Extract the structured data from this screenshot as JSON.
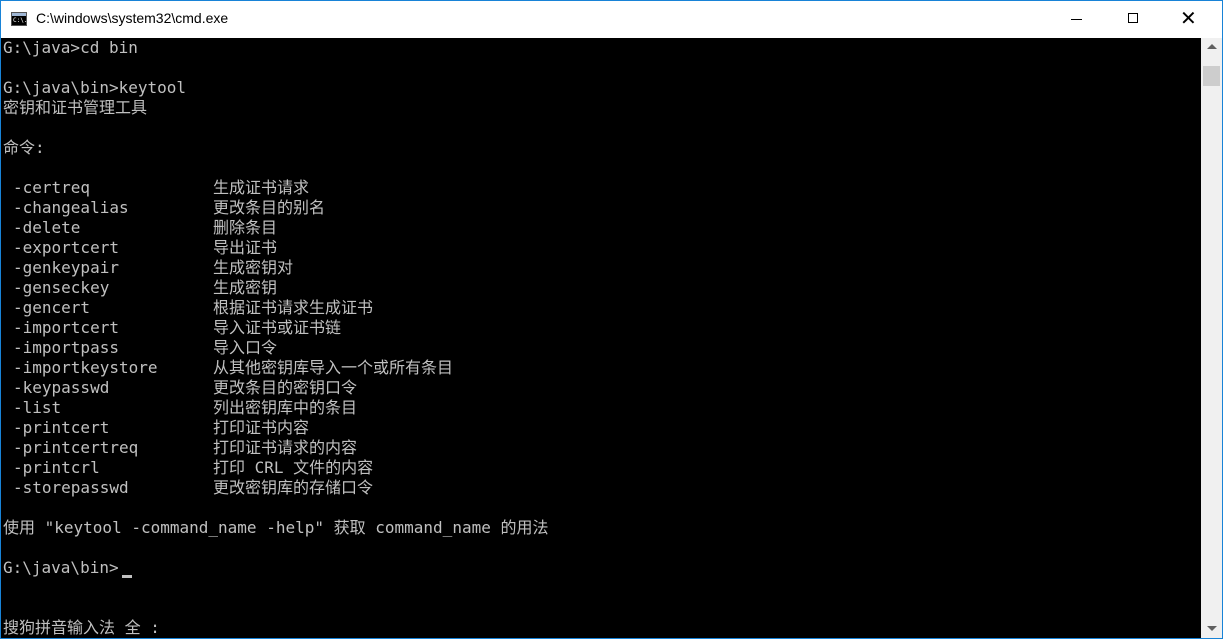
{
  "window": {
    "title": "C:\\windows\\system32\\cmd.exe",
    "icon_text": "C:\\."
  },
  "console": {
    "prompt_cd": "G:\\java>cd bin",
    "prompt_keytool": "G:\\java\\bin>keytool",
    "heading": "密钥和证书管理工具",
    "commands_label": "命令:",
    "commands": [
      {
        "name": "-certreq",
        "desc": "生成证书请求"
      },
      {
        "name": "-changealias",
        "desc": "更改条目的别名"
      },
      {
        "name": "-delete",
        "desc": "删除条目"
      },
      {
        "name": "-exportcert",
        "desc": "导出证书"
      },
      {
        "name": "-genkeypair",
        "desc": "生成密钥对"
      },
      {
        "name": "-genseckey",
        "desc": "生成密钥"
      },
      {
        "name": "-gencert",
        "desc": "根据证书请求生成证书"
      },
      {
        "name": "-importcert",
        "desc": "导入证书或证书链"
      },
      {
        "name": "-importpass",
        "desc": "导入口令"
      },
      {
        "name": "-importkeystore",
        "desc": "从其他密钥库导入一个或所有条目"
      },
      {
        "name": "-keypasswd",
        "desc": "更改条目的密钥口令"
      },
      {
        "name": "-list",
        "desc": "列出密钥库中的条目"
      },
      {
        "name": "-printcert",
        "desc": "打印证书内容"
      },
      {
        "name": "-printcertreq",
        "desc": "打印证书请求的内容"
      },
      {
        "name": "-printcrl",
        "desc": "打印 CRL 文件的内容"
      },
      {
        "name": "-storepasswd",
        "desc": "更改密钥库的存储口令"
      }
    ],
    "usage": "使用 \"keytool -command_name -help\" 获取 command_name 的用法",
    "prompt_final": "G:\\java\\bin>",
    "ime_status": "搜狗拼音输入法 全 :"
  },
  "colors": {
    "console_bg": "#000000",
    "console_text": "#c0c0c0",
    "titlebar_bg": "#ffffff",
    "window_border": "#1883d7"
  }
}
